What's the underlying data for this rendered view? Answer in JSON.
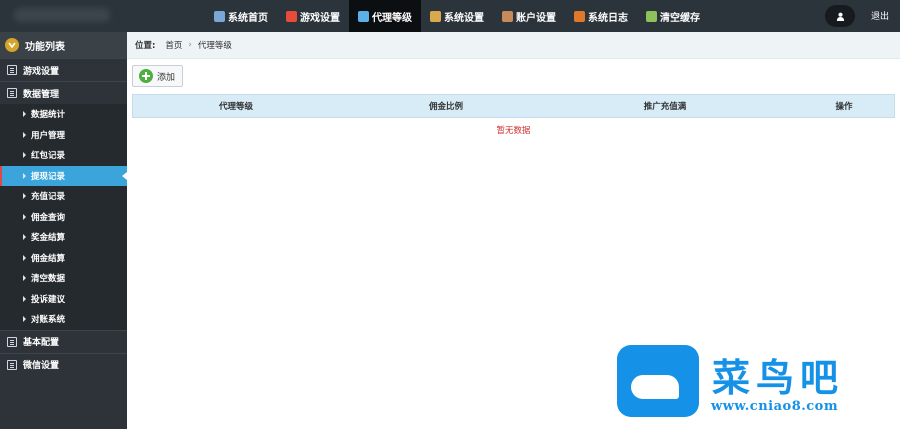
{
  "topbar": {
    "nav": [
      {
        "label": "系统首页",
        "icon": "home-icon",
        "color": "#7aa7d6",
        "active": false
      },
      {
        "label": "游戏设置",
        "icon": "game-icon",
        "color": "#e84b3c",
        "active": false
      },
      {
        "label": "代理等级",
        "icon": "globe-icon",
        "color": "#5bb0e8",
        "active": true
      },
      {
        "label": "系统设置",
        "icon": "tools-icon",
        "color": "#d9aa4b",
        "active": false
      },
      {
        "label": "账户设置",
        "icon": "user-icon",
        "color": "#c78a5a",
        "active": false
      },
      {
        "label": "系统日志",
        "icon": "book-icon",
        "color": "#e0772b",
        "active": false
      },
      {
        "label": "清空缓存",
        "icon": "network-icon",
        "color": "#8fc15a",
        "active": false
      }
    ],
    "logout_label": "退出"
  },
  "sidebar": {
    "title": "功能列表",
    "sections": [
      {
        "label": "游戏设置",
        "expanded": false,
        "items": []
      },
      {
        "label": "数据管理",
        "expanded": true,
        "items": [
          {
            "label": "数据统计",
            "active": false
          },
          {
            "label": "用户管理",
            "active": false
          },
          {
            "label": "红包记录",
            "active": false
          },
          {
            "label": "提现记录",
            "active": true
          },
          {
            "label": "充值记录",
            "active": false
          },
          {
            "label": "佣金查询",
            "active": false
          },
          {
            "label": "奖金结算",
            "active": false
          },
          {
            "label": "佣金结算",
            "active": false
          },
          {
            "label": "清空数据",
            "active": false
          },
          {
            "label": "投诉建议",
            "active": false
          },
          {
            "label": "对账系统",
            "active": false
          }
        ]
      },
      {
        "label": "基本配置",
        "expanded": false,
        "items": []
      },
      {
        "label": "微信设置",
        "expanded": false,
        "items": []
      }
    ]
  },
  "breadcrumb": {
    "label": "位置:",
    "items": [
      "首页",
      "代理等级"
    ]
  },
  "toolbar": {
    "add_label": "添加"
  },
  "table": {
    "columns": [
      "代理等级",
      "佣金比例",
      "推广充值满",
      "操作"
    ],
    "empty_text": "暂无数据"
  },
  "watermark": {
    "title": "菜鸟吧",
    "url": "www.cniao8.com"
  },
  "colors": {
    "topbar": "#2b333b",
    "sidebar": "#2d3339",
    "active_item": "#3ba4db",
    "table_header": "#d7ecf7",
    "empty_text": "#d12d2d",
    "watermark": "#1591e8"
  }
}
